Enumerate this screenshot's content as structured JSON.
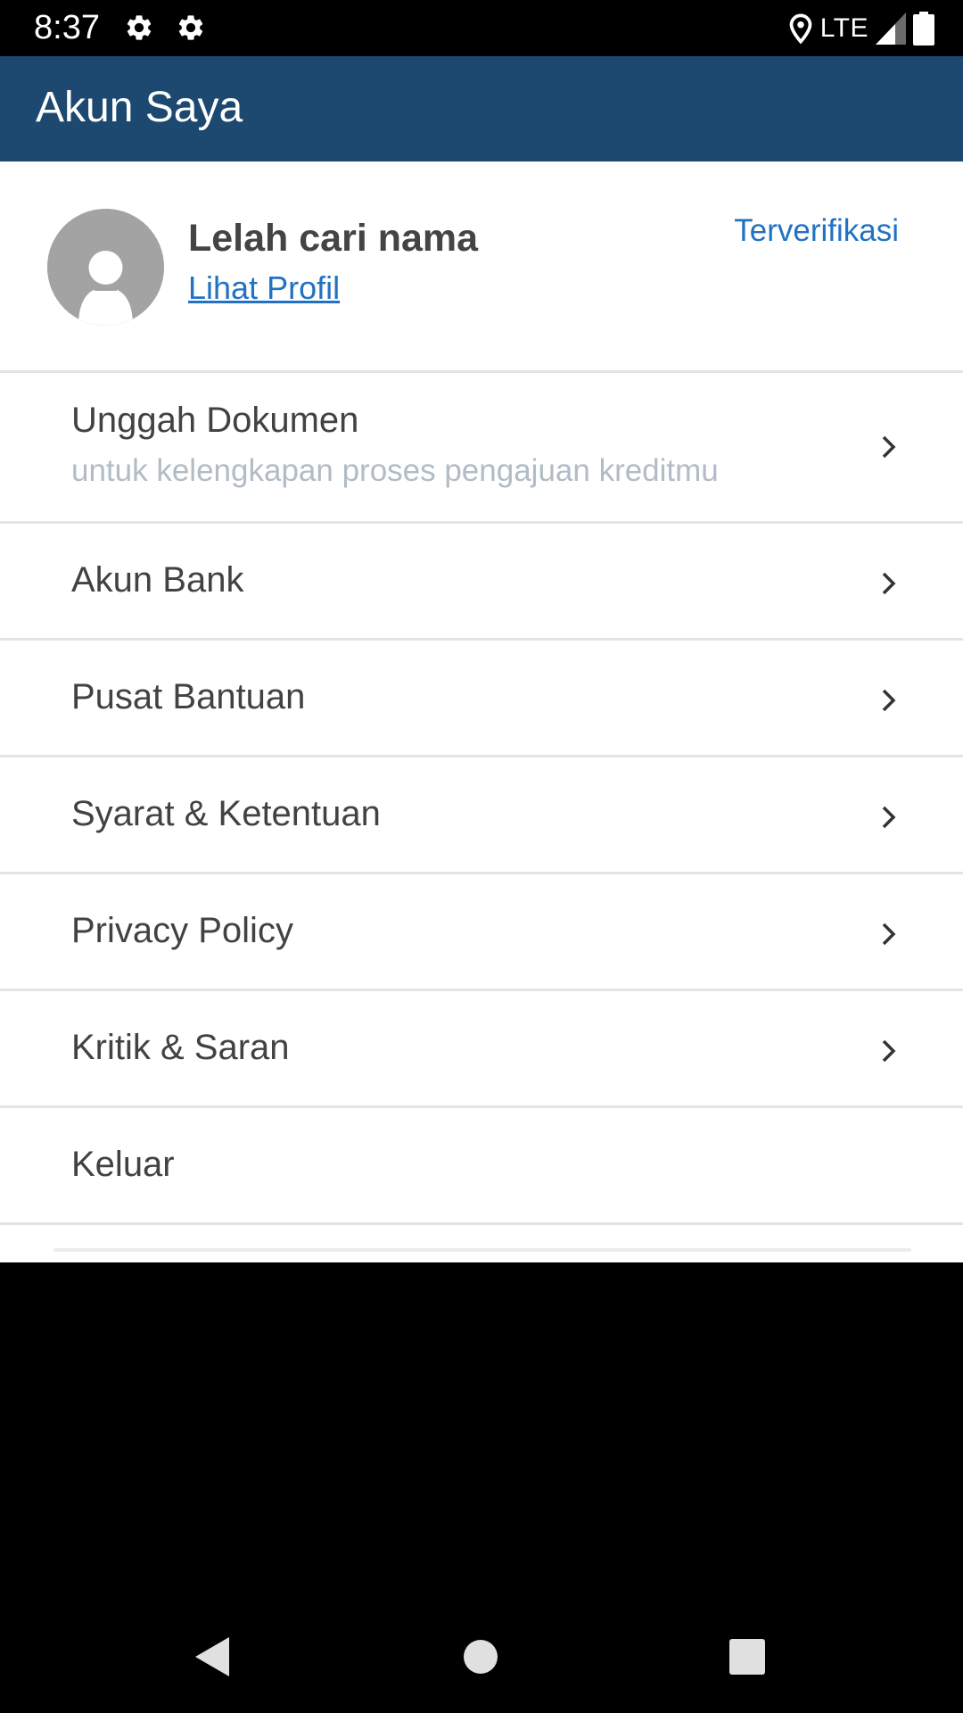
{
  "status_bar": {
    "time": "8:37",
    "network": "LTE",
    "icons": [
      "gear-icon",
      "gear-icon",
      "location-icon",
      "signal-icon",
      "battery-icon"
    ]
  },
  "app_bar": {
    "title": "Akun Saya",
    "color": "#1d4870"
  },
  "profile": {
    "name": "Lelah cari nama",
    "link": "Lihat Profil",
    "status": "Terverifikasi",
    "link_color": "#2272c3"
  },
  "menu": {
    "items": [
      {
        "label": "Unggah Dokumen",
        "subtitle": "untuk kelengkapan proses pengajuan kreditmu",
        "icon": "chevron-right-icon"
      },
      {
        "label": "Akun Bank",
        "icon": "chevron-right-icon"
      },
      {
        "label": "Pusat Bantuan",
        "icon": "chevron-right-icon"
      },
      {
        "label": "Syarat & Ketentuan",
        "icon": "chevron-right-icon"
      },
      {
        "label": "Privacy Policy",
        "icon": "chevron-right-icon"
      },
      {
        "label": "Kritik & Saran",
        "icon": "chevron-right-icon"
      },
      {
        "label": "Keluar"
      }
    ]
  },
  "nav_bar": {
    "icons": [
      "back-icon",
      "home-icon",
      "recents-icon"
    ]
  }
}
